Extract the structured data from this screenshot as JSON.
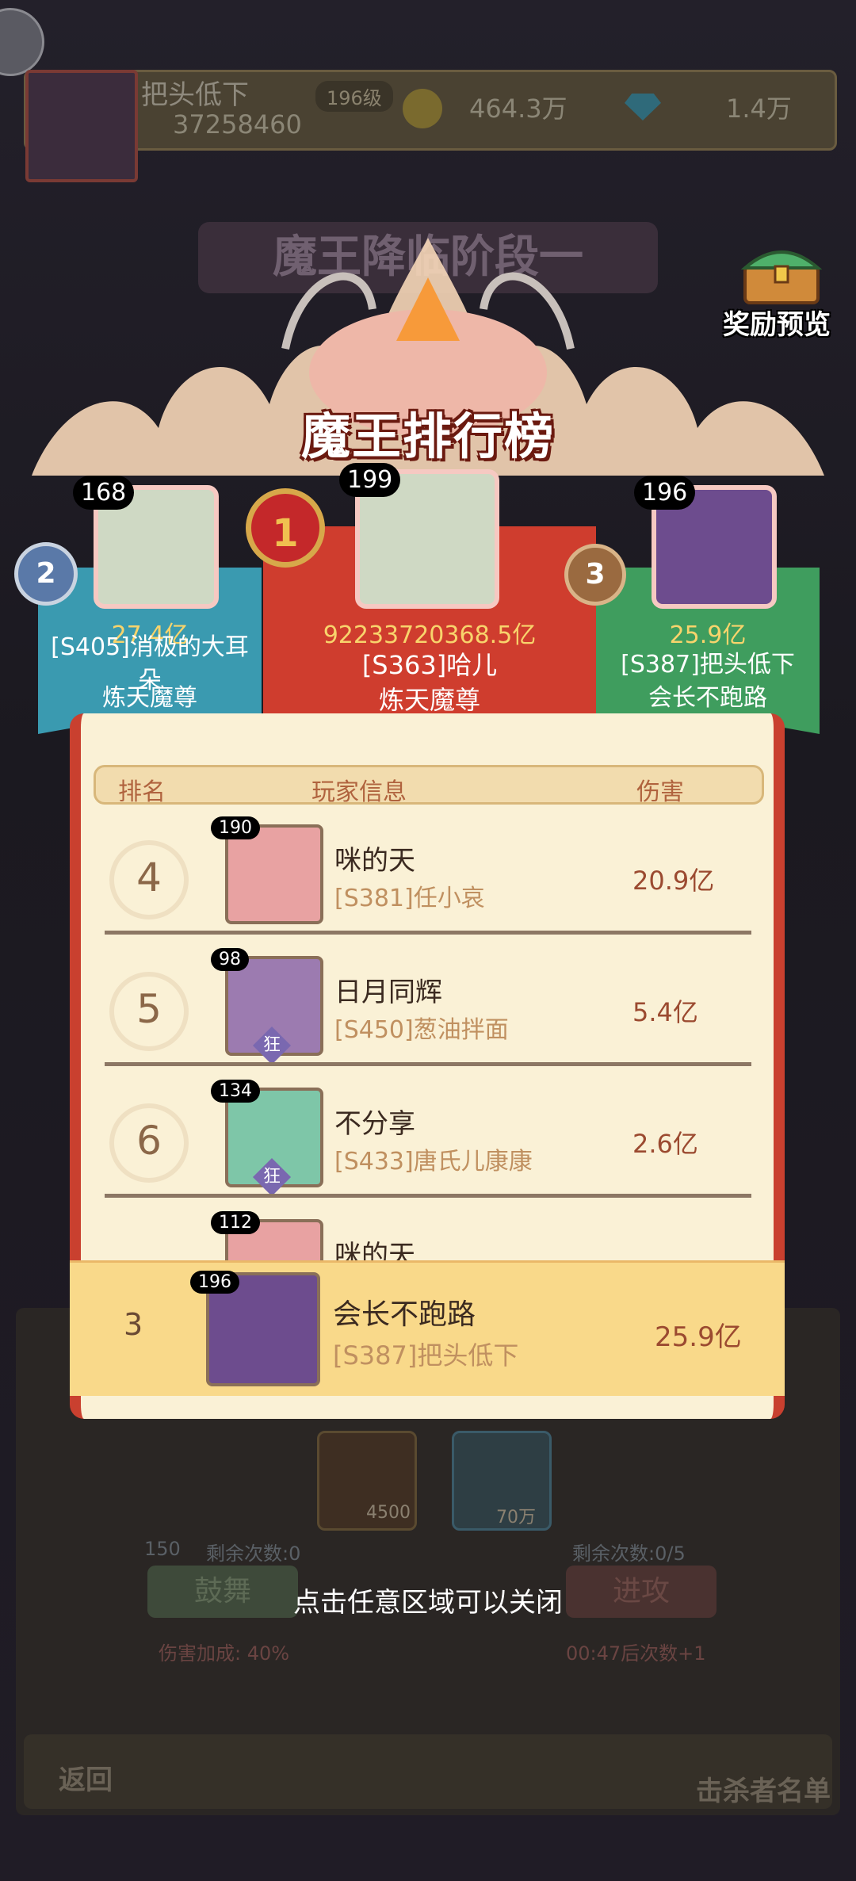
{
  "player_bar": {
    "name": "把头低下",
    "level": "196级",
    "score": "37258460",
    "coins": "464.3万",
    "gems": "1.4万"
  },
  "background": {
    "stage_title": "魔王降临阶段一",
    "gem_cost": "150",
    "remaining_left": "剩余次数:0",
    "remaining_right": "剩余次数:0/5",
    "boost_label": "鼓舞",
    "attack_label": "进攻",
    "damage_bonus": "伤害加成: 40%",
    "timer": "00:47后次数+1",
    "item1_qty": "4500",
    "item2_qty": "70万",
    "return_label": "返回",
    "killers_label": "击杀者名单"
  },
  "reward_preview": "奖励预览",
  "board_title": "魔王排行榜",
  "podium": [
    {
      "rank": "1",
      "level": "199",
      "damage": "92233720368.5亿",
      "server_name": "[S363]哈儿",
      "title": "炼天魔尊"
    },
    {
      "rank": "2",
      "level": "168",
      "damage": "27.4亿",
      "server_name": "[S405]消极的大耳朵",
      "title": "炼天魔尊"
    },
    {
      "rank": "3",
      "level": "196",
      "damage": "25.9亿",
      "server_name": "[S387]把头低下",
      "title": "会长不跑路"
    }
  ],
  "table_headers": {
    "rank": "排名",
    "player_info": "玩家信息",
    "damage": "伤害"
  },
  "rows": [
    {
      "rank": "4",
      "level": "190",
      "name": "咪的天",
      "guild": "[S381]任小哀",
      "damage": "20.9亿",
      "badge": ""
    },
    {
      "rank": "5",
      "level": "98",
      "name": "日月同辉",
      "guild": "[S450]葱油拌面",
      "damage": "5.4亿",
      "badge": "狂"
    },
    {
      "rank": "6",
      "level": "134",
      "name": "不分享",
      "guild": "[S433]唐氏儿康康",
      "damage": "2.6亿",
      "badge": "狂"
    },
    {
      "rank": "",
      "level": "112",
      "name": "咪的天",
      "guild": "",
      "damage": "",
      "badge": ""
    }
  ],
  "my_row": {
    "rank": "3",
    "level": "196",
    "name": "会长不跑路",
    "guild": "[S387]把头低下",
    "damage": "25.9亿"
  },
  "close_hint": "点击任意区域可以关闭",
  "colors": {
    "first": "#cf3d2e",
    "second": "#3a9ab0",
    "third": "#3f9d5e",
    "panel": "#faf1d6"
  },
  "icons": [
    "back-arrow-icon",
    "coin-icon",
    "gem-icon",
    "treasure-chest-icon",
    "dragon-icon"
  ]
}
